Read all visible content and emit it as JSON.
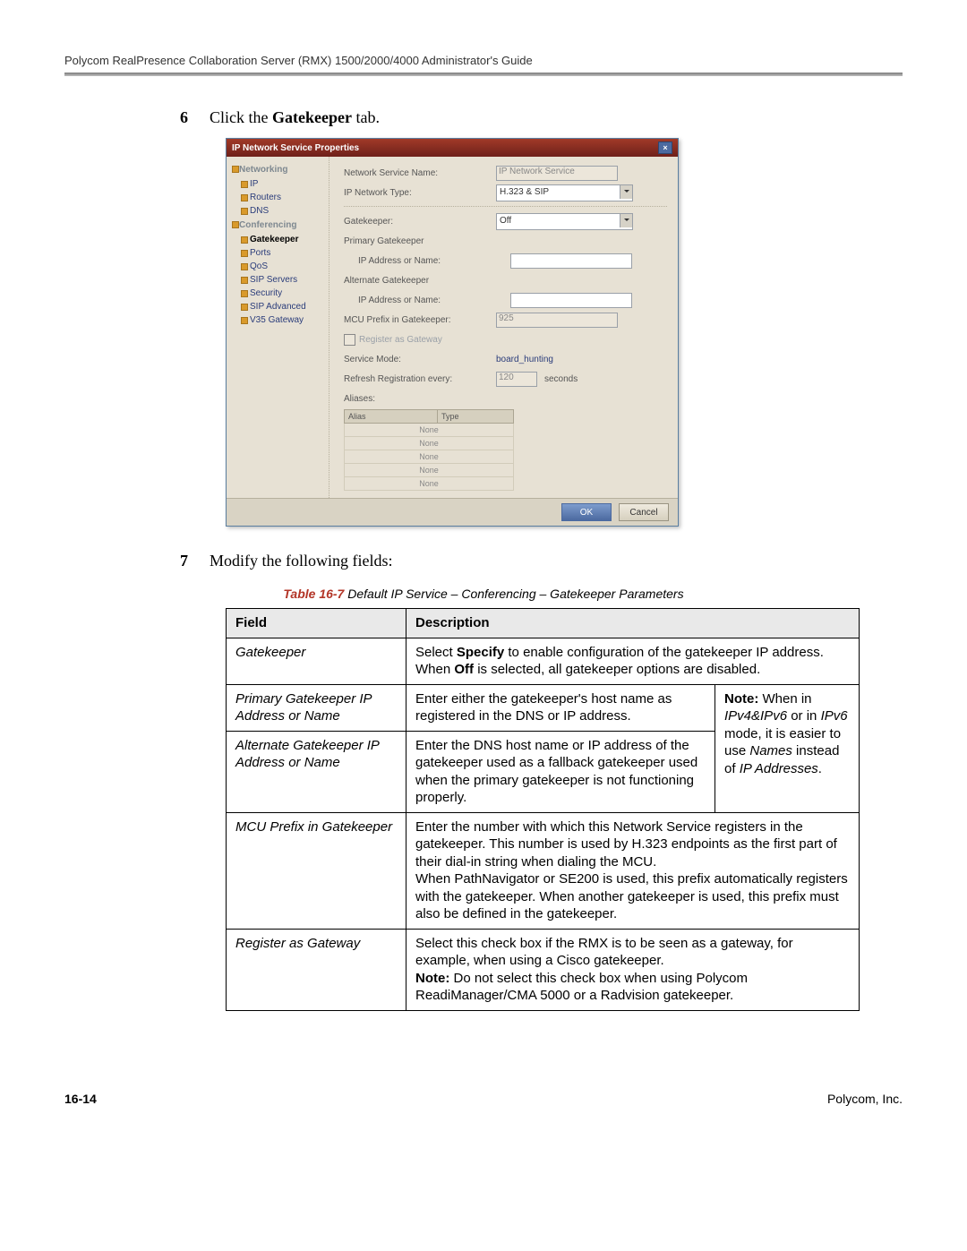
{
  "header": "Polycom RealPresence Collaboration Server (RMX) 1500/2000/4000 Administrator's Guide",
  "steps": {
    "s6": {
      "num": "6",
      "pre": "Click the ",
      "bold": "Gatekeeper",
      "post": " tab."
    },
    "s7": {
      "num": "7",
      "text": "Modify the following fields:"
    }
  },
  "dialog": {
    "title": "IP Network Service Properties",
    "nav": {
      "g1": "Networking",
      "i_ip": "IP",
      "i_routers": "Routers",
      "i_dns": "DNS",
      "g2": "Conferencing",
      "i_gk": "Gatekeeper",
      "i_ports": "Ports",
      "i_qos": "QoS",
      "i_sip": "SIP Servers",
      "i_sec": "Security",
      "i_sipadv": "SIP Advanced",
      "i_v35": "V35 Gateway"
    },
    "form": {
      "l_nsn": "Network Service Name:",
      "v_nsn": "IP Network Service",
      "l_ipnt": "IP Network Type:",
      "v_ipnt": "H.323 & SIP",
      "l_gk": "Gatekeeper:",
      "v_gk": "Off",
      "l_pgk": "Primary Gatekeeper",
      "l_ip1": "IP Address or Name:",
      "l_agk": "Alternate Gatekeeper",
      "l_ip2": "IP Address or Name:",
      "l_pref": "MCU Prefix in Gatekeeper:",
      "v_pref": "925",
      "l_reg": "Register as Gateway",
      "l_svc": "Service Mode:",
      "v_svc": "board_hunting",
      "l_refresh": "Refresh Registration every:",
      "v_refresh": "120",
      "u_refresh": "seconds",
      "l_aliases": "Aliases:",
      "th_alias": "Alias",
      "th_type": "Type",
      "none": "None"
    },
    "buttons": {
      "ok": "OK",
      "cancel": "Cancel"
    }
  },
  "caption": {
    "lead": "Table 16-7",
    "rest": " Default IP Service – Conferencing – Gatekeeper Parameters"
  },
  "table": {
    "h_field": "Field",
    "h_desc": "Description",
    "r1": {
      "f": "Gatekeeper",
      "d_a": "Select ",
      "d_b": "Specify",
      "d_c": " to enable configuration of the gatekeeper IP address.",
      "d2_a": "When ",
      "d2_b": "Off",
      "d2_c": " is selected, all gatekeeper options are disabled."
    },
    "r2": {
      "f": "Primary Gatekeeper IP Address or Name",
      "d": "Enter either the gatekeeper's host name as registered in the DNS or IP address."
    },
    "r3": {
      "f": "Alternate Gatekeeper IP Address or Name",
      "d": "Enter the DNS host name or IP address of the gatekeeper used as a fallback gatekeeper used when the primary gatekeeper is not functioning properly."
    },
    "side": {
      "a": "Note:",
      "b": " When in ",
      "c": "IPv4&IPv6",
      "d": " or in ",
      "e": "IPv6",
      "f": " mode, it is easier to use ",
      "g": "Names",
      "h": " instead of ",
      "i": "IP Addresses",
      "j": "."
    },
    "r4": {
      "f": "MCU Prefix in Gatekeeper",
      "d1": "Enter the number with which this Network Service registers in the gatekeeper. This number is used by H.323 endpoints as the first part of their dial-in string when dialing the MCU.",
      "d2": "When PathNavigator or SE200 is used, this prefix automatically registers with the gatekeeper. When another gatekeeper is used, this prefix must also be defined in the gatekeeper."
    },
    "r5": {
      "f": "Register as Gateway",
      "d1": "Select this check box if the RMX is to be seen as a gateway, for example, when using a Cisco gatekeeper.",
      "d2_a": "Note:",
      "d2_b": " Do not select this check box when using Polycom ReadiManager/CMA 5000 or a Radvision gatekeeper."
    }
  },
  "footer": {
    "page": "16-14",
    "co": "Polycom, Inc."
  }
}
